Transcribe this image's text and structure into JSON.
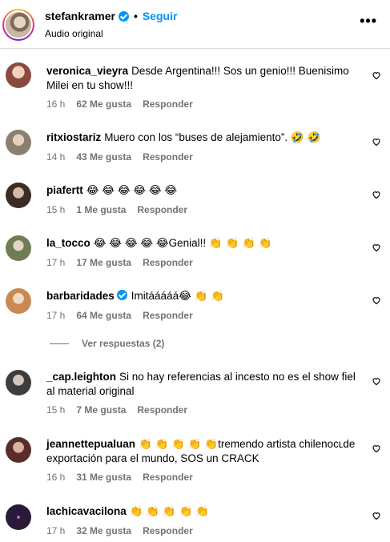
{
  "header": {
    "username": "stefankramer",
    "separator": "•",
    "follow_label": "Seguir",
    "subtitle": "Audio original",
    "more_label": "•••"
  },
  "comments": [
    {
      "username": "veronica_vieyra",
      "text": "Desde Argentina!!! Sos un genio!!! Buenisimo Milei en tu show!!!",
      "time": "16 h",
      "likes": "62 Me gusta",
      "reply": "Responder",
      "verified": false,
      "avatar_color": "#c08a7a"
    },
    {
      "username": "ritxiostariz",
      "text": "Muero con los “buses de alejamiento”. 🤣 🤣",
      "time": "14 h",
      "likes": "43 Me gusta",
      "reply": "Responder",
      "verified": false,
      "avatar_color": "#9a8c7d"
    },
    {
      "username": "piafertt",
      "text": "😂 😂 😂 😂 😂 😂",
      "time": "15 h",
      "likes": "1 Me gusta",
      "reply": "Responder",
      "verified": false,
      "avatar_color": "#5b4a43"
    },
    {
      "username": "la_tocco",
      "text": "😂 😂 😂 😂 😂Genial!! 👏 👏 👏 👏",
      "time": "17 h",
      "likes": "17 Me gusta",
      "reply": "Responder",
      "verified": false,
      "avatar_color": "#7a8a5b"
    },
    {
      "username": "barbaridades",
      "text": "Imitááááá😂 👏 👏",
      "time": "17 h",
      "likes": "64 Me gusta",
      "reply": "Responder",
      "verified": true,
      "avatar_color": "#d9a06a"
    },
    {
      "username": "_cap.leighton",
      "text": "Si no hay referencias al incesto no es el show fiel al material original",
      "time": "15 h",
      "likes": "7 Me gusta",
      "reply": "Responder",
      "verified": false,
      "avatar_color": "#4d4d4d"
    },
    {
      "username": "jeannettepualuan",
      "text": "👏 👏 👏 👏 👏tremendo artista chilenoᴄʟde exportación para el mundo, SOS un CRACK",
      "time": "16 h",
      "likes": "31 Me gusta",
      "reply": "Responder",
      "verified": false,
      "avatar_color": "#6b3b3b"
    },
    {
      "username": "lachicavacilona",
      "text": "👏 👏 👏 👏 👏",
      "time": "17 h",
      "likes": "32 Me gusta",
      "reply": "Responder",
      "verified": false,
      "avatar_color": "#2a1a3a"
    }
  ],
  "view_replies": "Ver respuestas (2)",
  "colors": {
    "accent": "#0095f6",
    "meta": "#737373",
    "divider": "#dbdbdb"
  }
}
